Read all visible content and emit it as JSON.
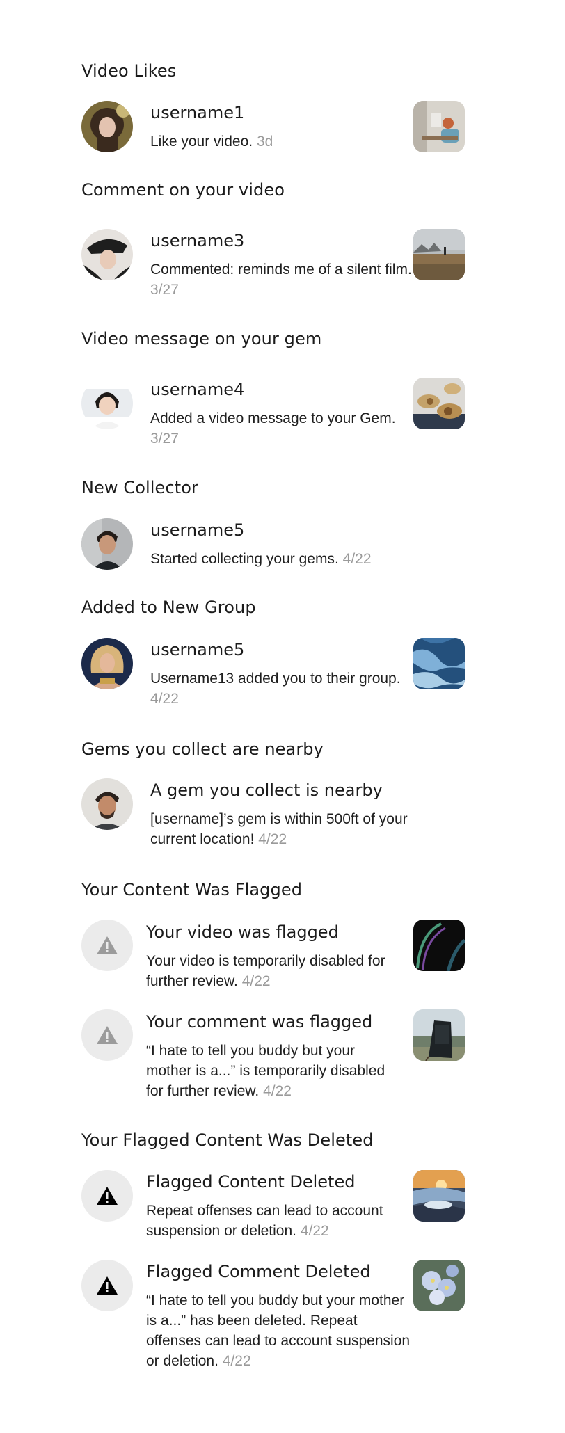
{
  "sections": {
    "video_likes": "Video Likes",
    "comment_on_video": "Comment on your video",
    "video_message_on_gem": "Video message on your gem",
    "new_collector": "New Collector",
    "added_to_group": "Added to New Group",
    "gems_nearby": "Gems you collect are nearby",
    "content_flagged": "Your Content Was Flagged",
    "flagged_deleted": "Your Flagged Content Was Deleted"
  },
  "notifications": {
    "like": {
      "title": "username1",
      "text": "Like your video.",
      "time": "3d"
    },
    "comment": {
      "title": "username3",
      "text": "Commented: reminds me of a silent film.",
      "time": "3/27"
    },
    "video_message": {
      "title": "username4",
      "text": "Added a video message to your Gem.",
      "time": "3/27"
    },
    "collector": {
      "title": "username5",
      "text": "Started collecting your gems.",
      "time": "4/22"
    },
    "group": {
      "title": "username5",
      "text": "Username13 added you to their group.",
      "time": "4/22"
    },
    "nearby": {
      "title": "A gem you collect is nearby",
      "text": "[username]’s gem is within 500ft of your current location!",
      "time": "4/22"
    },
    "video_flagged": {
      "title": "Your video was flagged",
      "text": "Your video is temporarily disabled for further review.",
      "time": "4/22"
    },
    "comment_flagged": {
      "title": "Your comment was flagged",
      "text": "“I hate to tell you buddy but your mother is a...” is temporarily disabled for further review.",
      "time": "4/22"
    },
    "content_deleted": {
      "title": "Flagged Content Deleted",
      "text": "Repeat offenses can lead to account suspension or deletion.",
      "time": "4/22"
    },
    "comment_deleted": {
      "title": "Flagged Comment Deleted",
      "text": "“I hate to tell you buddy but your mother is a...” has been deleted. Repeat offenses can lead to account suspension or deletion.",
      "time": "4/22"
    }
  },
  "icons": {
    "warning_flagged": "warning-triangle-icon",
    "warning_deleted": "warning-triangle-icon"
  },
  "colors": {
    "text": "#1b1b1b",
    "timestamp": "#9a9a9a",
    "warning_circle": "#ebebeb",
    "warning_flagged": "#9b9b9b",
    "warning_deleted": "#000000"
  }
}
